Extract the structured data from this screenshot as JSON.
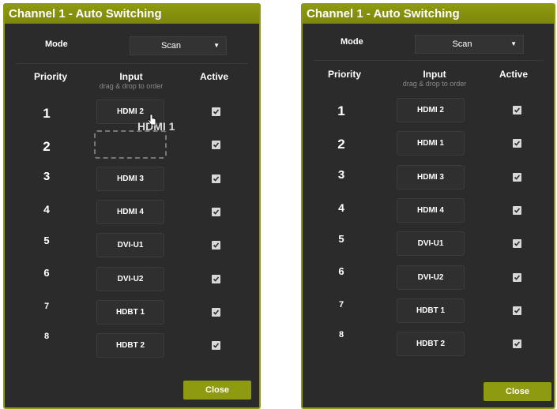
{
  "left_panel": {
    "title": "Channel 1 - Auto Switching",
    "mode_label": "Mode",
    "mode_value": "Scan",
    "headers": {
      "priority": "Priority",
      "input": "Input",
      "input_hint": "drag & drop to order",
      "active": "Active"
    },
    "rows": [
      {
        "priority": "1",
        "input": "HDMI 2",
        "active": true
      },
      {
        "priority": "2",
        "input": "",
        "active": true,
        "placeholder": true
      },
      {
        "priority": "3",
        "input": "HDMI 3",
        "active": true
      },
      {
        "priority": "4",
        "input": "HDMI 4",
        "active": true
      },
      {
        "priority": "5",
        "input": "DVI-U1",
        "active": true
      },
      {
        "priority": "6",
        "input": "DVI-U2",
        "active": true
      },
      {
        "priority": "7",
        "input": "HDBT 1",
        "active": true
      },
      {
        "priority": "8",
        "input": "HDBT 2",
        "active": true
      }
    ],
    "dragging_item": "HDMI 1",
    "close_label": "Close"
  },
  "right_panel": {
    "title": "Channel 1 - Auto Switching",
    "mode_label": "Mode",
    "mode_value": "Scan",
    "headers": {
      "priority": "Priority",
      "input": "Input",
      "input_hint": "drag & drop to order",
      "active": "Active"
    },
    "rows": [
      {
        "priority": "1",
        "input": "HDMI 2",
        "active": true
      },
      {
        "priority": "2",
        "input": "HDMI 1",
        "active": true
      },
      {
        "priority": "3",
        "input": "HDMI 3",
        "active": true
      },
      {
        "priority": "4",
        "input": "HDMI 4",
        "active": true
      },
      {
        "priority": "5",
        "input": "DVI-U1",
        "active": true
      },
      {
        "priority": "6",
        "input": "DVI-U2",
        "active": true
      },
      {
        "priority": "7",
        "input": "HDBT 1",
        "active": true
      },
      {
        "priority": "8",
        "input": "HDBT 2",
        "active": true
      }
    ],
    "close_label": "Close"
  },
  "colors": {
    "accent": "#8e9a10",
    "panel_bg": "#2b2b2b",
    "text": "#ffffff",
    "hint": "#8a8a8a"
  },
  "icons": {
    "mode_caret": "chevron-down-icon",
    "active_check": "checkbox-checked-icon",
    "drag_cursor": "hand-cursor-icon"
  }
}
